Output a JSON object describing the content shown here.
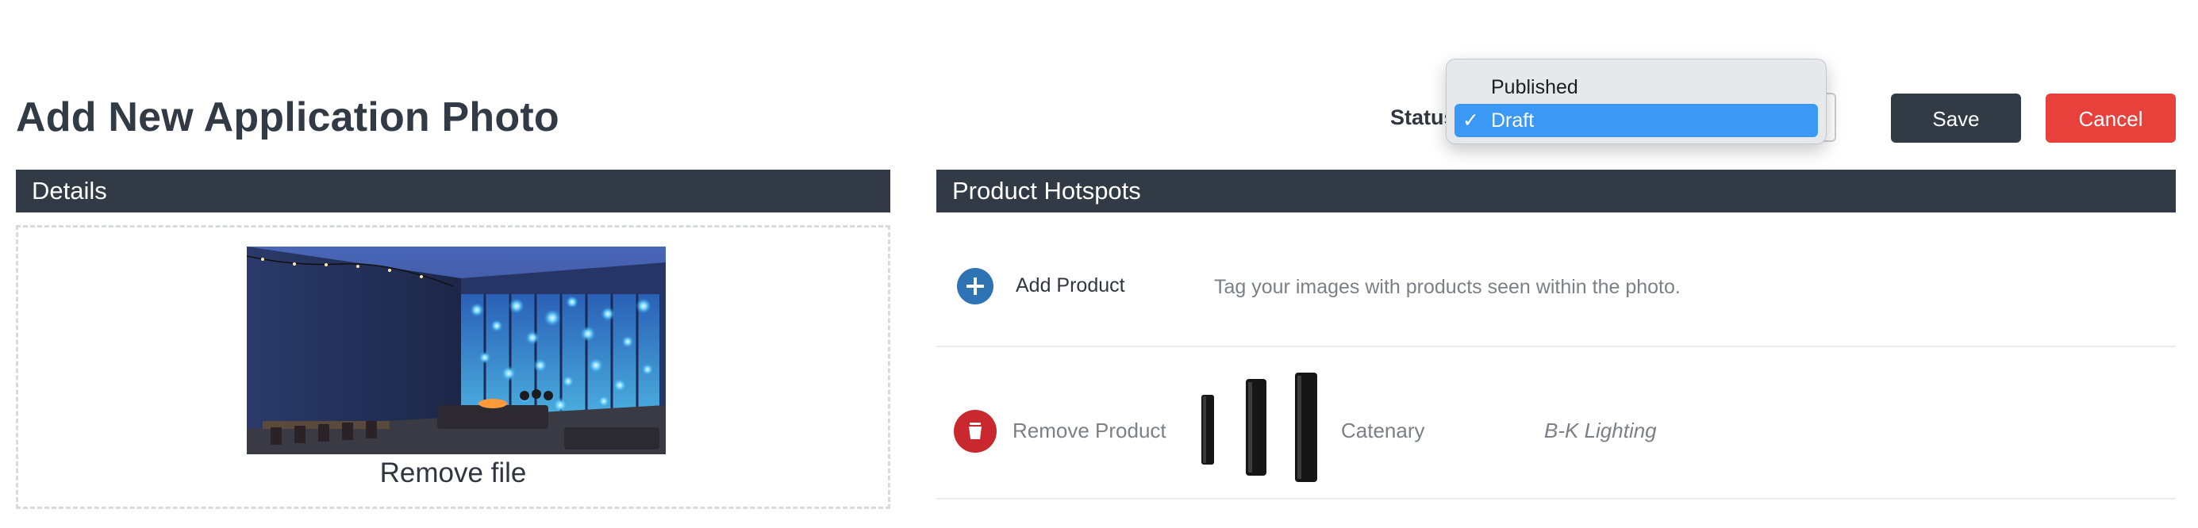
{
  "page": {
    "title": "Add New Application Photo"
  },
  "header": {
    "status_label": "Status",
    "status_options": [
      "Published",
      "Draft"
    ],
    "status_selected": "Draft",
    "save_label": "Save",
    "cancel_label": "Cancel"
  },
  "details": {
    "section_title": "Details",
    "remove_file_label": "Remove file",
    "photo_icon": "application-photo-image"
  },
  "hotspots": {
    "section_title": "Product Hotspots",
    "add_product_label": "Add Product",
    "add_product_hint": "Tag your images with products seen within the photo.",
    "products": [
      {
        "remove_label": "Remove Product",
        "name": "Catenary",
        "brand": "B-K Lighting",
        "thumbnail_icon": "catenary-product-image"
      }
    ]
  },
  "colors": {
    "dark": "#323a45",
    "danger": "#e8413b",
    "add_blue": "#2e74b5",
    "remove_red": "#c8282e",
    "select_highlight": "#3b98f5"
  }
}
